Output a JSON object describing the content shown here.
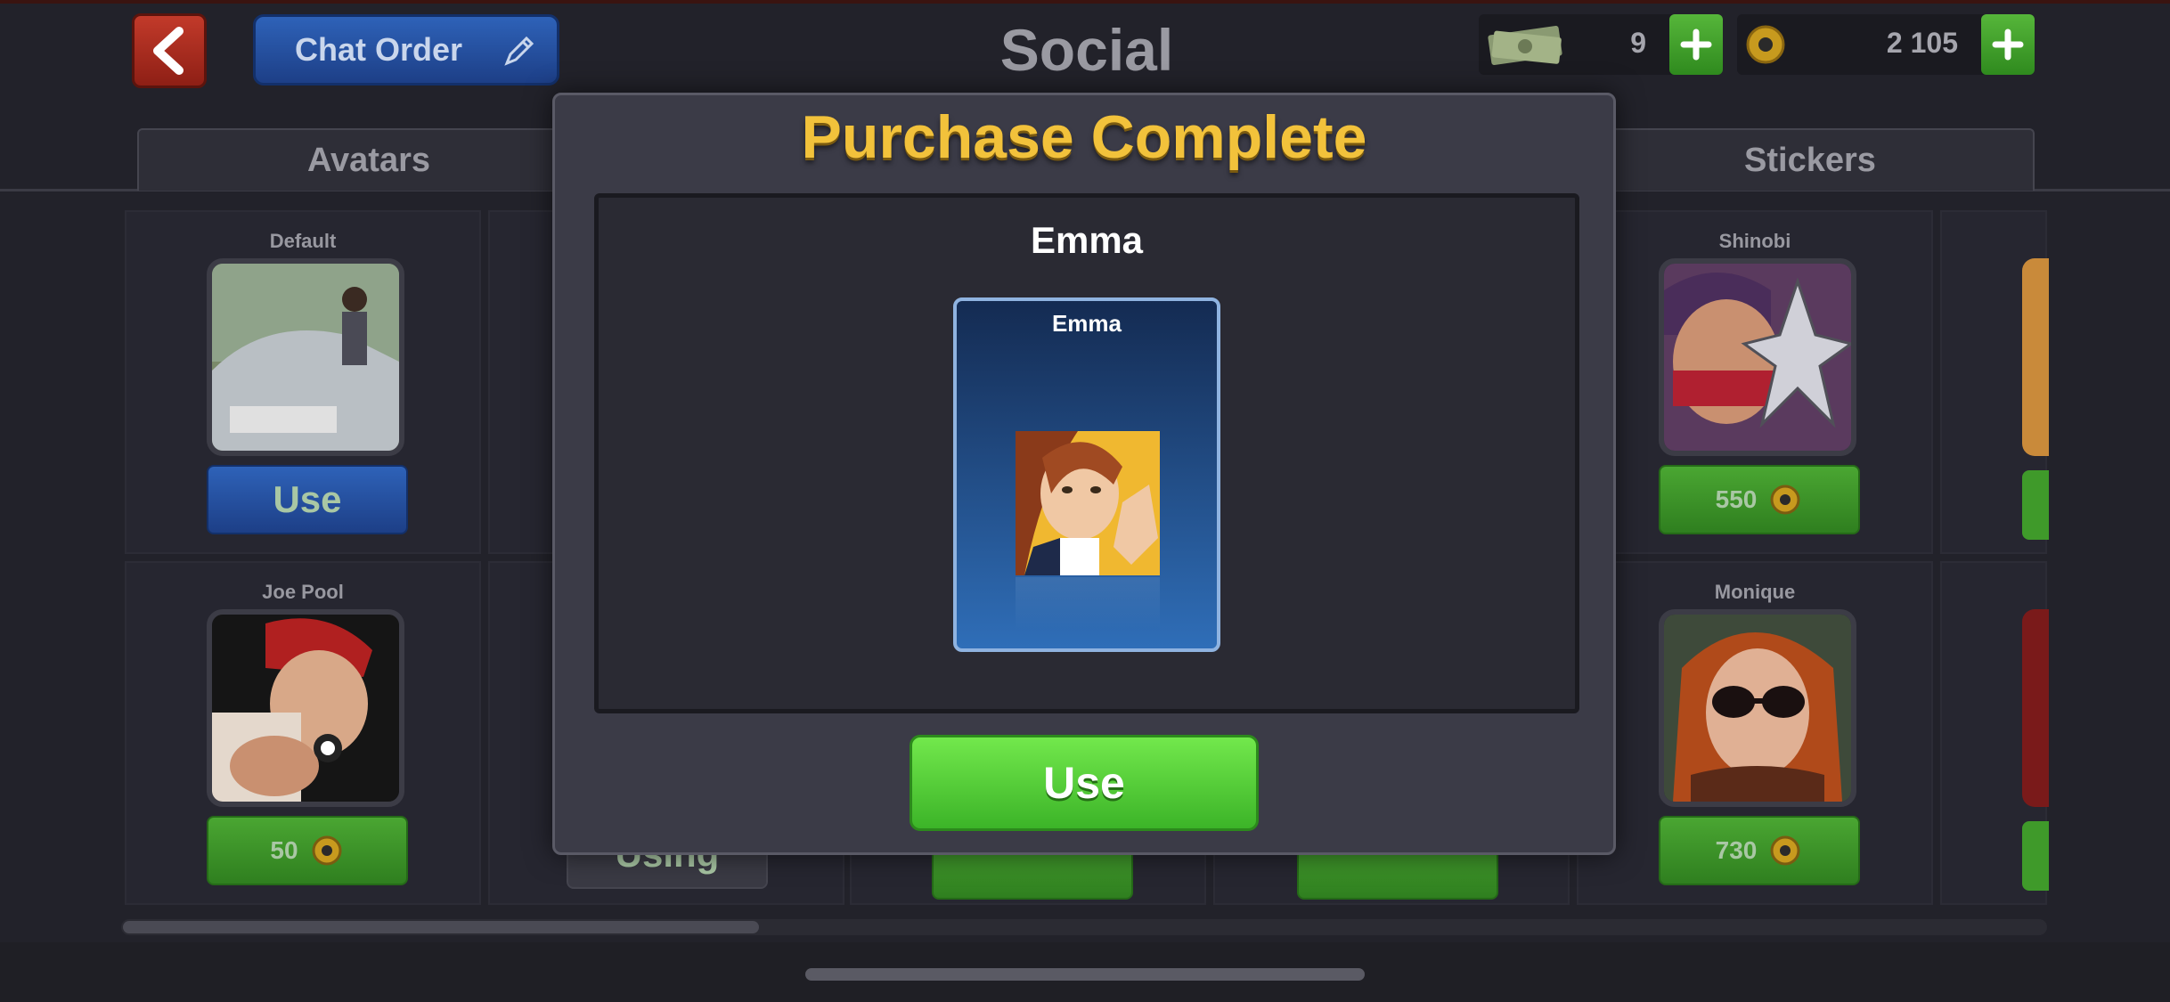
{
  "header": {
    "title": "Social",
    "chat_order_label": "Chat Order",
    "cash_value": "9",
    "coins_value": "2 105"
  },
  "tabs": [
    {
      "label": "Avatars",
      "active": true
    },
    {
      "label": "Stickers",
      "active": false
    }
  ],
  "grid": {
    "row1": [
      {
        "name": "Default",
        "action": "Use",
        "action_type": "use"
      },
      {
        "name": "Shinobi",
        "action": "550",
        "action_type": "price"
      }
    ],
    "row2": [
      {
        "name": "Joe Pool",
        "action": "50",
        "action_type": "price"
      },
      {
        "name": "",
        "action": "Using",
        "action_type": "using"
      },
      {
        "name": "Monique",
        "action": "730",
        "action_type": "price"
      }
    ]
  },
  "modal": {
    "title": "Purchase Complete",
    "item_name": "Emma",
    "card_label": "Emma",
    "use_label": "Use"
  },
  "colors": {
    "accent_gold": "#f2c23b",
    "button_green": "#4aa632",
    "button_blue": "#2e62b8",
    "background": "#22222a"
  },
  "icons": [
    "back-arrow-icon",
    "pencil-icon",
    "cash-icon",
    "coin-icon",
    "plus-icon"
  ]
}
